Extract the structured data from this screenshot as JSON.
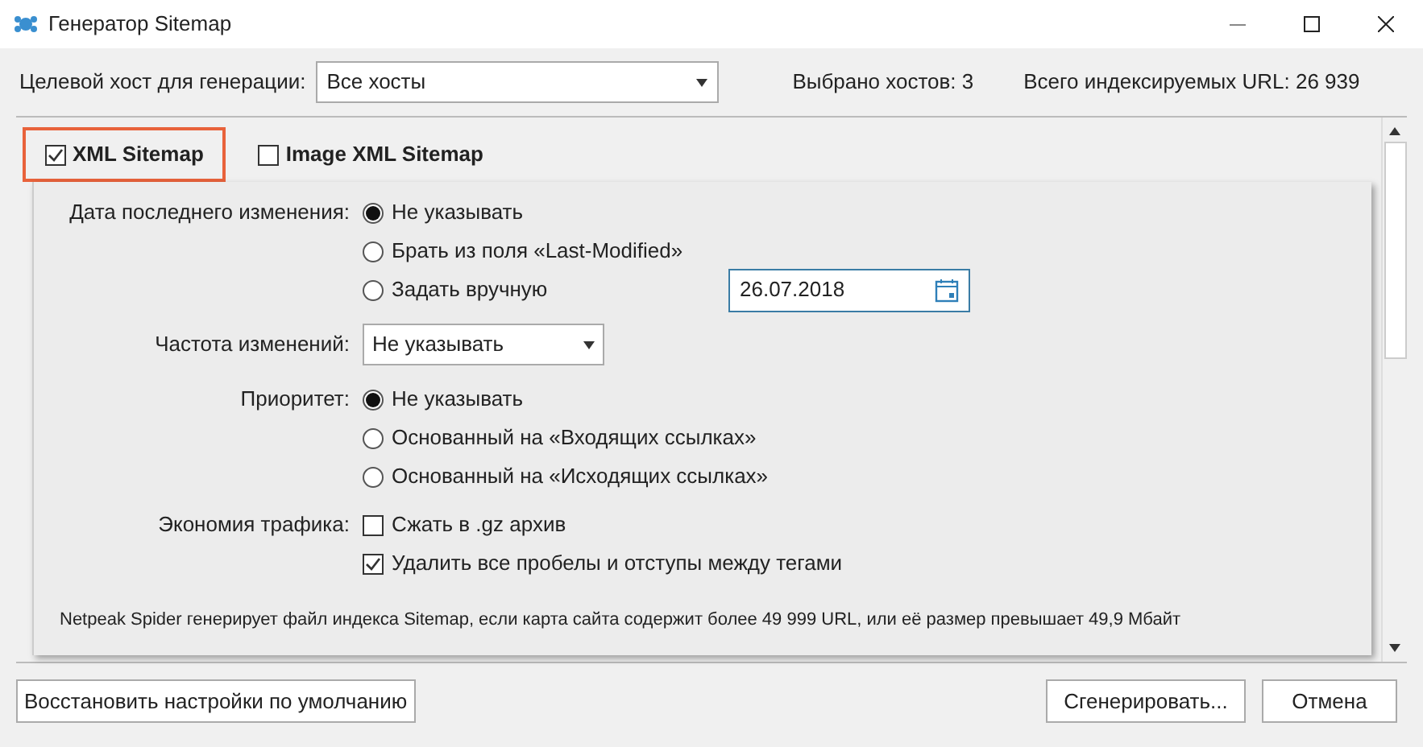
{
  "window": {
    "title": "Генератор Sitemap"
  },
  "host": {
    "label": "Целевой хост для генерации:",
    "value": "Все хосты",
    "selected_hosts": "Выбрано хостов: 3",
    "total_urls": "Всего индексируемых URL: 26 939"
  },
  "sitemap_types": [
    {
      "label": "XML Sitemap",
      "checked": true,
      "highlighted": true
    },
    {
      "label": "Image XML Sitemap",
      "checked": false,
      "highlighted": false
    }
  ],
  "settings": [
    {
      "kind": "radio",
      "label": "Дата последнего изменения:",
      "options": [
        {
          "label": "Не указывать",
          "selected": true
        },
        {
          "label": "Брать из поля «Last-Modified»",
          "selected": false
        },
        {
          "label": "Задать вручную",
          "selected": false,
          "date": "26.07.2018"
        }
      ]
    },
    {
      "kind": "select",
      "label": "Частота изменений:",
      "value": "Не указывать"
    },
    {
      "kind": "radio",
      "label": "Приоритет:",
      "options": [
        {
          "label": "Не указывать",
          "selected": true
        },
        {
          "label": "Основанный на «Входящих ссылках»",
          "selected": false
        },
        {
          "label": "Основанный на «Исходящих ссылках»",
          "selected": false
        }
      ]
    },
    {
      "kind": "checks",
      "label": "Экономия трафика:",
      "options": [
        {
          "label": "Сжать в .gz архив",
          "checked": false
        },
        {
          "label": "Удалить все пробелы и отступы между тегами",
          "checked": true
        }
      ]
    }
  ],
  "note": "Netpeak Spider генерирует файл индекса Sitemap, если карта сайта содержит более 49 999 URL, или её размер превышает 49,9 Мбайт",
  "buttons": {
    "reset": "Восстановить настройки по умолчанию",
    "generate": "Сгенерировать...",
    "cancel": "Отмена"
  }
}
